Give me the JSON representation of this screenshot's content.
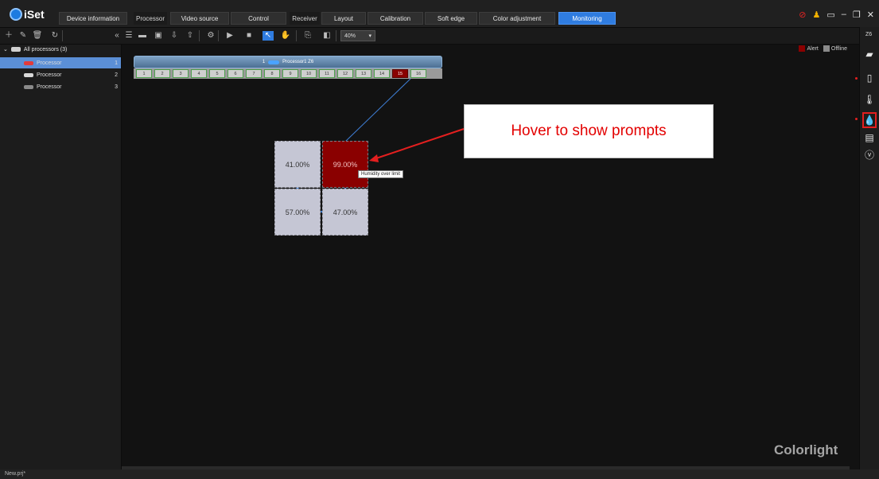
{
  "app": {
    "logo": "iSet"
  },
  "menu": {
    "device_info": "Device information",
    "processor_group": "Processor",
    "video_source": "Video source",
    "control": "Control",
    "receiver_group": "Receiver",
    "layout": "Layout",
    "calibration": "Calibration",
    "soft_edge": "Soft edge",
    "color_adjustment": "Color adjustment",
    "monitoring": "Monitoring"
  },
  "toolbar": {
    "zoom": "40%"
  },
  "sidebar": {
    "root_label": "All processors (3)",
    "items": [
      {
        "label": "Processor",
        "num": "1"
      },
      {
        "label": "Processor",
        "num": "2"
      },
      {
        "label": "Processor",
        "num": "3"
      }
    ]
  },
  "canvas": {
    "processor_label": "Processor1 Z6",
    "processor_index": "1",
    "ports": [
      "1",
      "2",
      "3",
      "4",
      "5",
      "6",
      "7",
      "8",
      "9",
      "10",
      "11",
      "12",
      "13",
      "14",
      "15",
      "16"
    ],
    "alert_port": "15",
    "legend": {
      "alert": "Alert",
      "offline": "Offline"
    },
    "cabinets": [
      {
        "value": "41.00%"
      },
      {
        "value": "99.00%"
      },
      {
        "value": "57.00%"
      },
      {
        "value": "47.00%"
      }
    ],
    "tooltip": "Humidity over limit",
    "callout": "Hover to show prompts",
    "brand": "Colorlight"
  },
  "right_panel": {
    "title": "Z6"
  },
  "status": {
    "file": "New.prj*"
  },
  "colors": {
    "accent": "#2f7ce0",
    "alert": "#8a0000",
    "callout_text": "#e30000",
    "cabinet": "#c5c6d4"
  }
}
